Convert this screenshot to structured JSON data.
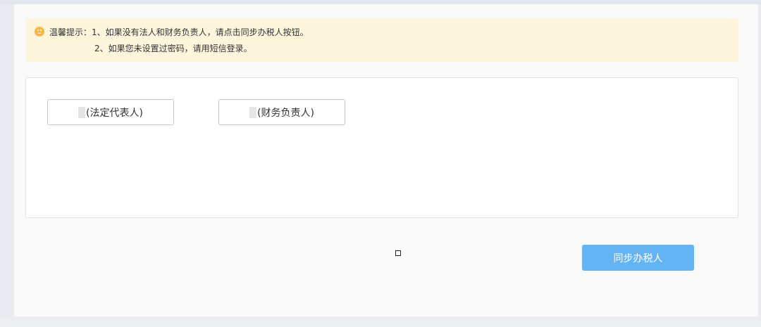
{
  "notice": {
    "icon": "smile-icon",
    "line1": "温馨提示：1、如果没有法人和财务负责人，请点击同步办税人按钮。",
    "line2": "2、如果您未设置过密码，请用短信登录。"
  },
  "roles": {
    "legal_rep_label": "(法定代表人)",
    "finance_head_label": "(财务负责人)"
  },
  "actions": {
    "sync_label": "同步办税人"
  },
  "colors": {
    "notice_bg": "#fdf6dd",
    "notice_icon": "#f6b84a",
    "primary_button": "#64b4f3"
  }
}
